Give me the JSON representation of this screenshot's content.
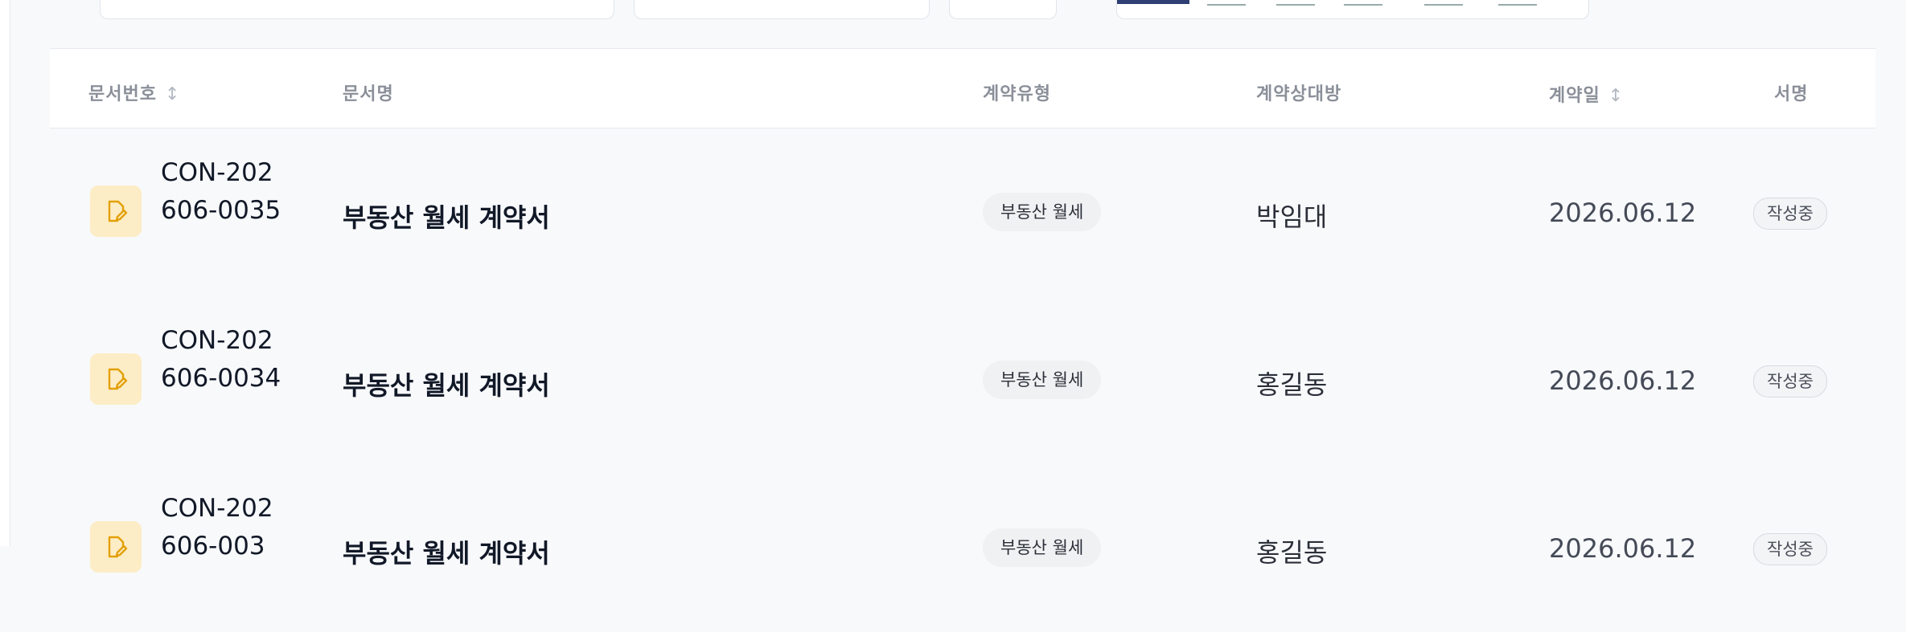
{
  "table": {
    "headers": {
      "doc_no": "문서번호",
      "doc_name": "문서명",
      "contract_type": "계약유형",
      "counterparty": "계약상대방",
      "contract_date": "계약일",
      "signature": "서명"
    },
    "sort_glyph": "↕",
    "rows": [
      {
        "doc_no": "CON-202606-0035",
        "doc_name": "부동산 월세 계약서",
        "contract_type": "부동산 월세",
        "counterparty": "박임대",
        "contract_date": "2026.06.12",
        "signature_status": "작성중",
        "icon": "document-edit-icon"
      },
      {
        "doc_no": "CON-202606-0034",
        "doc_name": "부동산 월세 계약서",
        "contract_type": "부동산 월세",
        "counterparty": "홍길동",
        "contract_date": "2026.06.12",
        "signature_status": "작성중",
        "icon": "document-edit-icon"
      },
      {
        "doc_no": "CON-202606-003",
        "doc_name": "부동산 월세 계약서",
        "contract_type": "부동산 월세",
        "counterparty": "홍길동",
        "contract_date": "2026.06.12",
        "signature_status": "작성중",
        "icon": "document-edit-icon"
      }
    ]
  },
  "colors": {
    "accent": "#2f3f74",
    "icon_bg": "#fdedc6",
    "icon_stroke": "#e3a008",
    "background": "#f8f9fb"
  }
}
